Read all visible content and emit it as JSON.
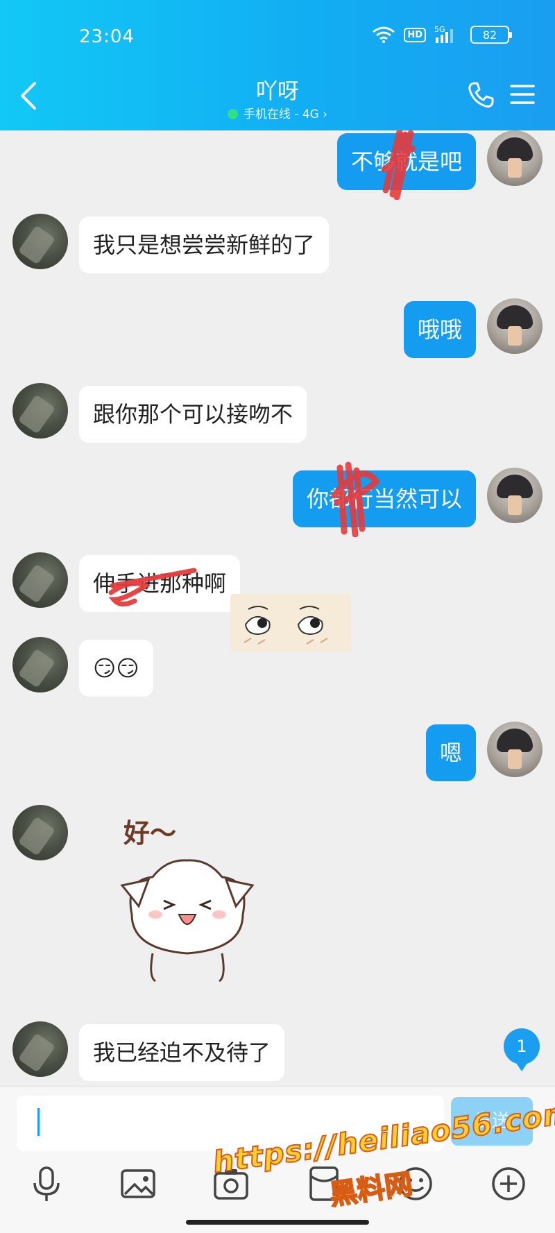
{
  "status_bar": {
    "time": "23:04",
    "hd_label": "HD",
    "network": "5G",
    "battery": "82"
  },
  "header": {
    "title": "吖呀",
    "status_prefix": "手机在线 - 4G",
    "status_chevron": "›",
    "online_color": "#2fe089",
    "accent": "#12aef3"
  },
  "messages": [
    {
      "from": "me",
      "text": "不够就是吧"
    },
    {
      "from": "them",
      "text": "我只是想尝尝新鲜的了"
    },
    {
      "from": "me",
      "text": "哦哦"
    },
    {
      "from": "them",
      "text": "跟你那个可以接吻不"
    },
    {
      "from": "me",
      "text": "你都行当然可以"
    },
    {
      "from": "them",
      "text": "伸手进那种啊"
    },
    {
      "from": "them",
      "text": "😏😏"
    },
    {
      "from": "me",
      "text": "嗯"
    },
    {
      "from": "them",
      "sticker": "cat-sticker",
      "sticker_text": "好～"
    },
    {
      "from": "them",
      "text": "我已经迫不及待了"
    }
  ],
  "unread_count": "1",
  "input": {
    "placeholder": "",
    "send_label": "发送"
  },
  "toolbar": [
    {
      "icon": "microphone-icon"
    },
    {
      "icon": "image-icon"
    },
    {
      "icon": "camera-icon"
    },
    {
      "icon": "red-packet-icon"
    },
    {
      "icon": "emoji-icon"
    },
    {
      "icon": "plus-icon"
    }
  ],
  "watermark": {
    "url": "https://heiliao56.com",
    "text": "黑料网"
  }
}
